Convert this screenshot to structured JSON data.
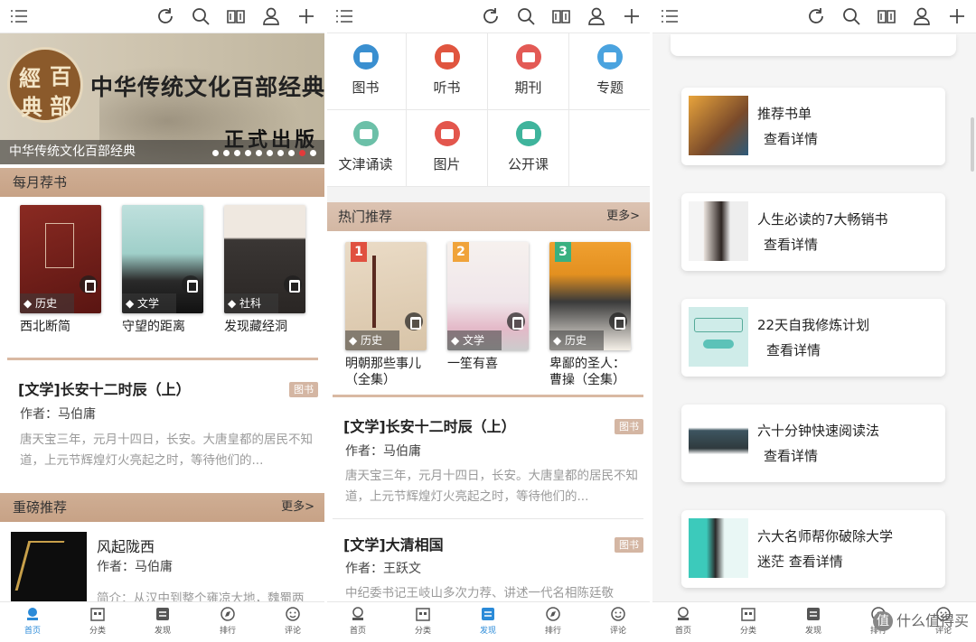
{
  "screen1": {
    "banner": {
      "seal_chars": [
        "經",
        "百",
        "典",
        "部"
      ],
      "title": "中华传统文化百部经典",
      "subtitle": "正式出版",
      "caption": "中华传统文化百部经典"
    },
    "section_monthly": "每月荐书",
    "books": [
      {
        "title": "西北断简",
        "category": "历史"
      },
      {
        "title": "守望的距离",
        "category": "文学"
      },
      {
        "title": "发现藏经洞",
        "category": "社科"
      }
    ],
    "article": {
      "title": "[文学]长安十二时辰（上）",
      "tag": "图书",
      "author": "作者：马伯庸",
      "desc": "唐天宝三年，元月十四日，长安。大唐皇都的居民不知道，上元节辉煌灯火亮起之时，等待他们的..."
    },
    "section_featured": "重磅推荐",
    "more": "更多>",
    "featured": {
      "title": "风起陇西",
      "author": "作者：马伯庸",
      "desc": "简介：从汉中到整个雍凉大地，魏蜀两"
    }
  },
  "screen2": {
    "grid": [
      {
        "label": "图书",
        "color": "#3a8fd0"
      },
      {
        "label": "听书",
        "color": "#e0553f"
      },
      {
        "label": "期刊",
        "color": "#e35a55"
      },
      {
        "label": "专题",
        "color": "#4aa3df"
      },
      {
        "label": "文津诵读",
        "color": "#6cc0a8"
      },
      {
        "label": "图片",
        "color": "#e3564d"
      },
      {
        "label": "公开课",
        "color": "#3fb49c"
      }
    ],
    "section_hot": "热门推荐",
    "more": "更多>",
    "books": [
      {
        "title": "明朝那些事儿（全集）",
        "category": "历史",
        "rank": "1"
      },
      {
        "title": "一笙有喜",
        "category": "文学",
        "rank": "2"
      },
      {
        "title": "卑鄙的圣人：曹操（全集）",
        "category": "历史",
        "rank": "3"
      }
    ],
    "articles": [
      {
        "title": "[文学]长安十二时辰（上）",
        "tag": "图书",
        "author": "作者：马伯庸",
        "desc": "唐天宝三年，元月十四日，长安。大唐皇都的居民不知道，上元节辉煌灯火亮起之时，等待他们的..."
      },
      {
        "title": "[文学]大清相国",
        "tag": "图书",
        "author": "作者：王跃文",
        "desc": "中纪委书记王岐山多次力荐、讲述一代名相陈廷敬"
      }
    ]
  },
  "screen3": {
    "cards": [
      {
        "title": "推荐书单",
        "action": "查看详情"
      },
      {
        "title": "人生必读的7大畅销书",
        "action": "查看详情"
      },
      {
        "title": "22天自我修炼计划",
        "action": "查看详情"
      },
      {
        "title": "六十分钟快速阅读法",
        "action": "查看详情"
      },
      {
        "title": "六大名师帮你破除大学",
        "action": "迷茫  查看详情"
      }
    ],
    "watermark": "什么值得买",
    "watermark_badge": "值"
  },
  "nav": [
    "首页",
    "分类",
    "发现",
    "排行",
    "评论"
  ]
}
